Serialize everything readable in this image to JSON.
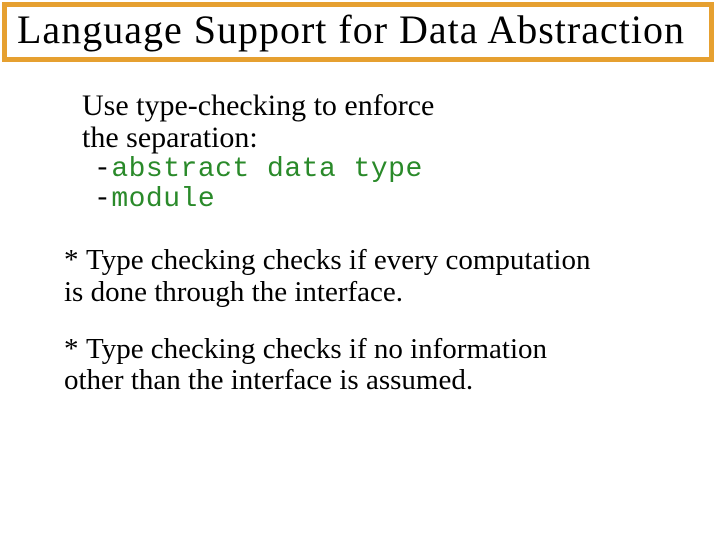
{
  "title": "Language Support for Data Abstraction",
  "intro": {
    "line1": "Use type-checking to enforce",
    "line2": "the separation:",
    "code1": "abstract data type",
    "code2": "module"
  },
  "bullets": [
    {
      "line1": "Type checking checks if every computation",
      "line2": "is done through the interface."
    },
    {
      "line1": "Type checking checks if no information",
      "line2": "other than the interface is assumed."
    }
  ]
}
